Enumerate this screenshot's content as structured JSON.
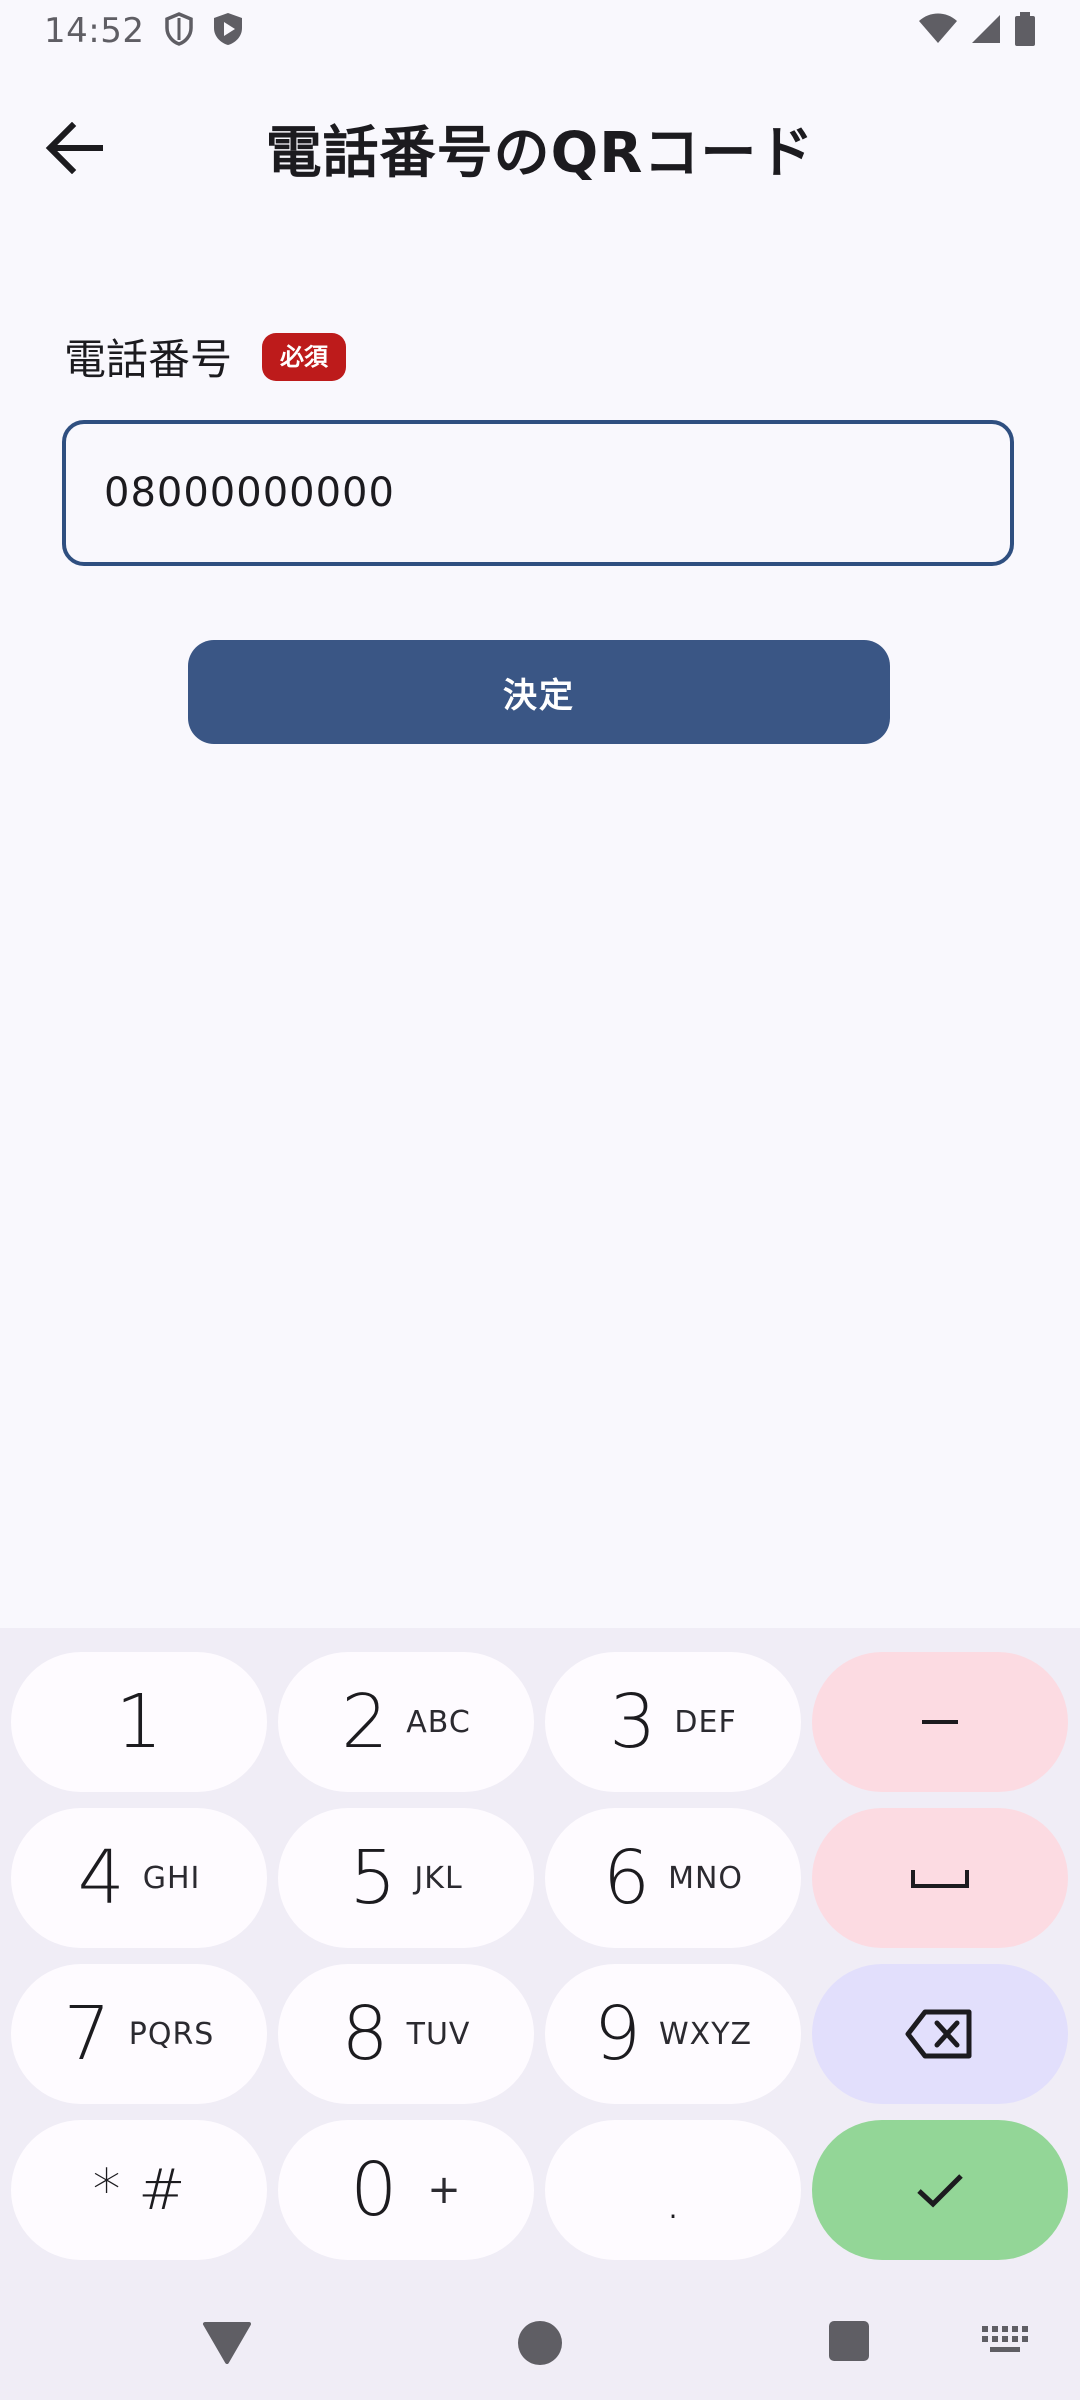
{
  "status_bar": {
    "time": "14:52"
  },
  "app_bar": {
    "title": "電話番号のQRコード"
  },
  "form": {
    "label": "電話番号",
    "required_badge": "必須",
    "phone_value": "08000000000",
    "submit_label": "決定"
  },
  "keyboard": {
    "rows": [
      [
        {
          "digit": "1",
          "letters": ""
        },
        {
          "digit": "2",
          "letters": "ABC"
        },
        {
          "digit": "3",
          "letters": "DEF"
        }
      ],
      [
        {
          "digit": "4",
          "letters": "GHI"
        },
        {
          "digit": "5",
          "letters": "JKL"
        },
        {
          "digit": "6",
          "letters": "MNO"
        }
      ],
      [
        {
          "digit": "7",
          "letters": "PQRS"
        },
        {
          "digit": "8",
          "letters": "TUV"
        },
        {
          "digit": "9",
          "letters": "WXYZ"
        }
      ],
      [
        {
          "digit": "* #",
          "letters": ""
        },
        {
          "digit": "0",
          "letters": "+"
        },
        {
          "digit": ".",
          "letters": ""
        }
      ]
    ],
    "side_keys": [
      "minus-key",
      "space-key",
      "backspace-key",
      "done-key"
    ]
  },
  "colors": {
    "accent": "#3a5685",
    "badge": "#bd1b1b",
    "key_pink": "#fcdbe2",
    "key_lavender": "#e2dffc",
    "key_green": "#93d697"
  }
}
